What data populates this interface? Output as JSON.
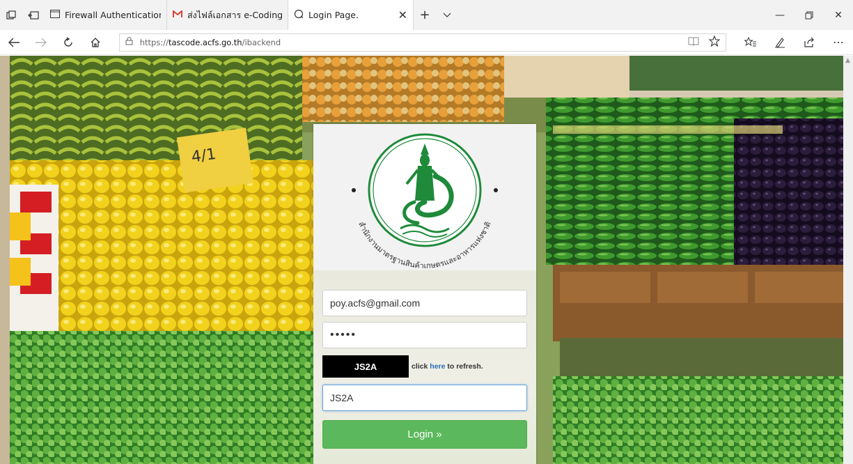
{
  "browser": {
    "tabs": [
      {
        "label": "Firewall Authentication Keep",
        "icon": "page-icon"
      },
      {
        "label": "ส่งไฟล์เอกสาร e-Coding ของต่",
        "icon": "gmail-icon"
      },
      {
        "label": "Login Page.",
        "icon": "loading-icon",
        "active": true
      }
    ],
    "address": {
      "scheme": "https://",
      "host": "tascode.acfs.go.th",
      "path": "/ibackend"
    }
  },
  "login": {
    "email_value": "poy.acfs@gmail.com",
    "password_mask": "•••••",
    "captcha_code": "JS2A",
    "captcha_note_before": "click ",
    "captcha_note_link": "here",
    "captcha_note_after": " to refresh.",
    "captcha_input_value": "JS2A",
    "button_label": "Login »"
  },
  "logo": {
    "seal_text": "สำนักงานมาตรฐานสินค้าเกษตรและอาหารแห่งชาติ",
    "color": "#1e8a3a"
  },
  "colors": {
    "login_button": "#5cb85c",
    "link": "#2a6db8",
    "captcha_bg": "#000000"
  }
}
